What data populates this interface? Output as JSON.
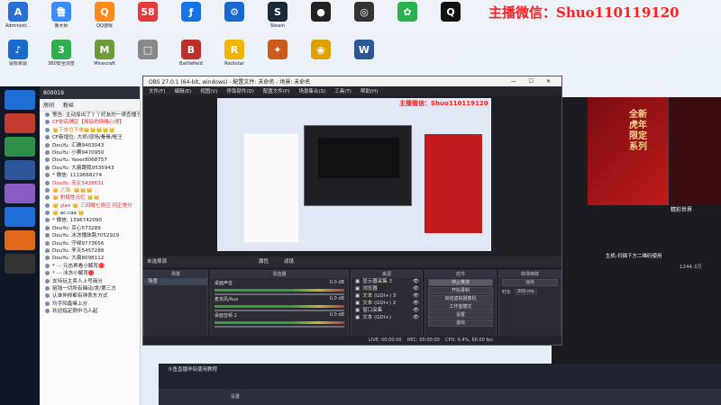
{
  "watermark": "主播微信：Shuo110119120",
  "desktop_icons": [
    {
      "label": "Administr...",
      "color": "#2a6fd6",
      "g": "A"
    },
    {
      "label": "鲁大师",
      "color": "#3a8cff",
      "g": "鲁"
    },
    {
      "label": "QQ游戏",
      "color": "#ff8a1a",
      "g": "Q"
    },
    {
      "label": "",
      "color": "#e33b3b",
      "g": "58"
    },
    {
      "label": "",
      "color": "#1473e6",
      "g": "ƒ"
    },
    {
      "label": "",
      "color": "#1769d1",
      "g": "⚙"
    },
    {
      "label": "Steam",
      "color": "#1b2838",
      "g": "S"
    },
    {
      "label": "",
      "color": "#222",
      "g": "●"
    },
    {
      "label": "",
      "color": "#333",
      "g": "◎"
    },
    {
      "label": "",
      "color": "#2bb24c",
      "g": "✿"
    },
    {
      "label": "",
      "color": "#111",
      "g": "Q"
    }
  ],
  "desktop_icons_row2": [
    {
      "label": "鼠标资源",
      "color": "#1a6acc",
      "g": "♪"
    },
    {
      "label": "360安全浏览",
      "color": "#2fae4e",
      "g": "3"
    },
    {
      "label": "Minecraft",
      "color": "#6d9a3a",
      "g": "M"
    },
    {
      "label": "",
      "color": "#888",
      "g": "□"
    },
    {
      "label": "Battlefield",
      "color": "#c0302a",
      "g": "B"
    },
    {
      "label": "Rockstar",
      "color": "#f0b400",
      "g": "R"
    },
    {
      "label": "",
      "color": "#cc5a1a",
      "g": "✦"
    },
    {
      "label": "",
      "color": "#e0a000",
      "g": "◉"
    },
    {
      "label": "",
      "color": "#2b579a",
      "g": "W"
    }
  ],
  "chat": {
    "title": "800019",
    "tab1": "房间",
    "tab2": "粉丝",
    "lines": [
      {
        "t": "警告: 主动加出了丫丫好友的一律查播子",
        "c": ""
      },
      {
        "t": "CF你店铺区【用玩的网格心得】",
        "c": "red"
      },
      {
        "t": "👑下单位下单👑👑👑👑👑",
        "c": "orange"
      },
      {
        "t": "CF新增位: 大师/现场/骨骨/枪王",
        "c": ""
      },
      {
        "t": "DouYu: 汇确9403043",
        "c": ""
      },
      {
        "t": "DouYu: 小赛9470950",
        "c": ""
      },
      {
        "t": "DouYu: Yaser8068757",
        "c": ""
      },
      {
        "t": "DouYu: 大扁跟我9535943",
        "c": ""
      },
      {
        "t": "* 微信: 1119668274",
        "c": ""
      },
      {
        "t": "DouYu: 无尘5438631",
        "c": "red"
      },
      {
        "t": "👑 之锋: 👑👑👑",
        "c": "orange"
      },
      {
        "t": "👑 积极性元亿 👑👑",
        "c": "red"
      },
      {
        "t": "👑 yleo 👑 三闪哦七供应 闪正常分",
        "c": "red"
      },
      {
        "t": "👑 ac.caa 👑",
        "c": ""
      },
      {
        "t": "* 微信: 1396742090",
        "c": ""
      },
      {
        "t": "DouYu: 京心573289",
        "c": ""
      },
      {
        "t": "DouYu: 冰冻播抹路7052929",
        "c": ""
      },
      {
        "t": "DouYu: 守候9773656",
        "c": ""
      },
      {
        "t": "DouYu: 李天5457288",
        "c": ""
      },
      {
        "t": "DouYu: 大扁8098112",
        "c": ""
      },
      {
        "t": "* ⋯ 元态再看小解背🔴",
        "c": ""
      },
      {
        "t": "* ⋯ 冰冻小解背🔴",
        "c": ""
      },
      {
        "t": "支持玩主卖人上号商分",
        "c": ""
      },
      {
        "t": "赔钱一切所有赌动/发/第三方",
        "c": ""
      },
      {
        "t": "认准仲邦都有钟表东方式",
        "c": ""
      },
      {
        "t": "均手阳鑫嘛上分",
        "c": ""
      },
      {
        "t": "欢迎指定刚中马人起",
        "c": ""
      }
    ]
  },
  "obs": {
    "title": "OBS 27.0.1 (64-bit, windows) - 配置文件: 未命名 - 场景: 未命名",
    "menu": [
      "文件(F)",
      "编辑(E)",
      "视图(V)",
      "停靠部件(D)",
      "配置文件(P)",
      "场景集合(S)",
      "工具(T)",
      "帮助(H)"
    ],
    "no_source": "未选择源",
    "properties": "属性",
    "filters": "滤镜",
    "docks": {
      "scenes_header": "场景",
      "scene_item": "场景",
      "mixer_header": "混音器",
      "mixer": [
        {
          "name": "桌面声音",
          "db": "0.0 dB"
        },
        {
          "name": "麦克风/Aux",
          "db": "0.0 dB"
        },
        {
          "name": "桌面音频 2",
          "db": "0.0 dB"
        }
      ],
      "sources_header": "来源",
      "sources": [
        "显示器采集 3",
        "浏览器",
        "文本 (GDI+) 3",
        "文本 (GDI+) 2",
        "窗口采集",
        "文本 (GDI+)"
      ],
      "controls_header": "控件",
      "controls": [
        "停止推流",
        "开始录制",
        "启动虚拟摄像机",
        "工作室模式",
        "设置",
        "退出"
      ],
      "transitions_header": "转场特效",
      "transition": "淡出",
      "duration_label": "时长",
      "duration": "300 ms"
    },
    "status": "LIVE: 00:00:00    REC: 00:00:00    CPU: 6.4%, 60.00 fps"
  },
  "right_panel": {
    "banner_lines": [
      "全新",
      "虎年",
      "限定",
      "系列"
    ],
    "item1": "精彩世界",
    "item2": "生机-扫描下方二维码使用",
    "stat": "1244.3万"
  },
  "taskbar": {
    "notice": "斗鱼直播伴侣使用教程",
    "time": "设置"
  }
}
